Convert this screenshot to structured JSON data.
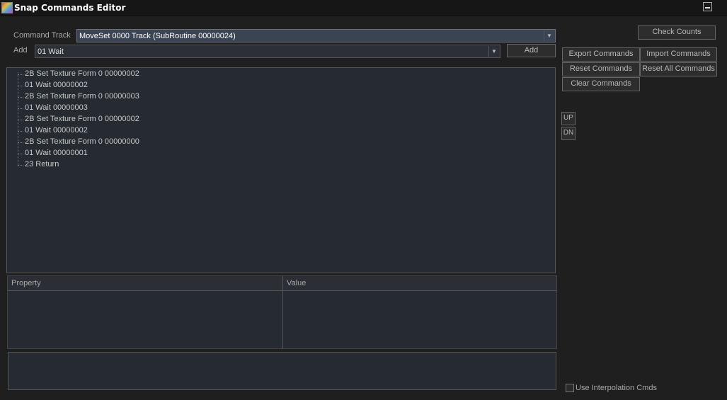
{
  "window": {
    "title": "Snap Commands Editor"
  },
  "command_track": {
    "label": "Command Track",
    "value": "MoveSet 0000 Track  (SubRoutine 00000024)"
  },
  "add_row": {
    "label": "Add",
    "value": "01 Wait",
    "button": "Add"
  },
  "buttons": {
    "check_counts": "Check Counts",
    "export_commands": "Export Commands",
    "import_commands": "Import Commands",
    "reset_commands": "Reset Commands",
    "reset_all_commands": "Reset All Commands",
    "clear_commands": "Clear Commands",
    "up": "UP",
    "dn": "DN"
  },
  "commands": [
    "2B Set Texture Form 0 00000002",
    "01 Wait 00000002",
    "2B Set Texture Form 0 00000003",
    "01 Wait 00000003",
    "2B Set Texture Form 0 00000002",
    "01 Wait 00000002",
    "2B Set Texture Form 0 00000000",
    "01 Wait 00000001",
    "23 Return"
  ],
  "property_grid": {
    "col_property": "Property",
    "col_value": "Value"
  },
  "options": {
    "use_interpolation": "Use Interpolation Cmds",
    "use_interpolation_checked": false
  }
}
